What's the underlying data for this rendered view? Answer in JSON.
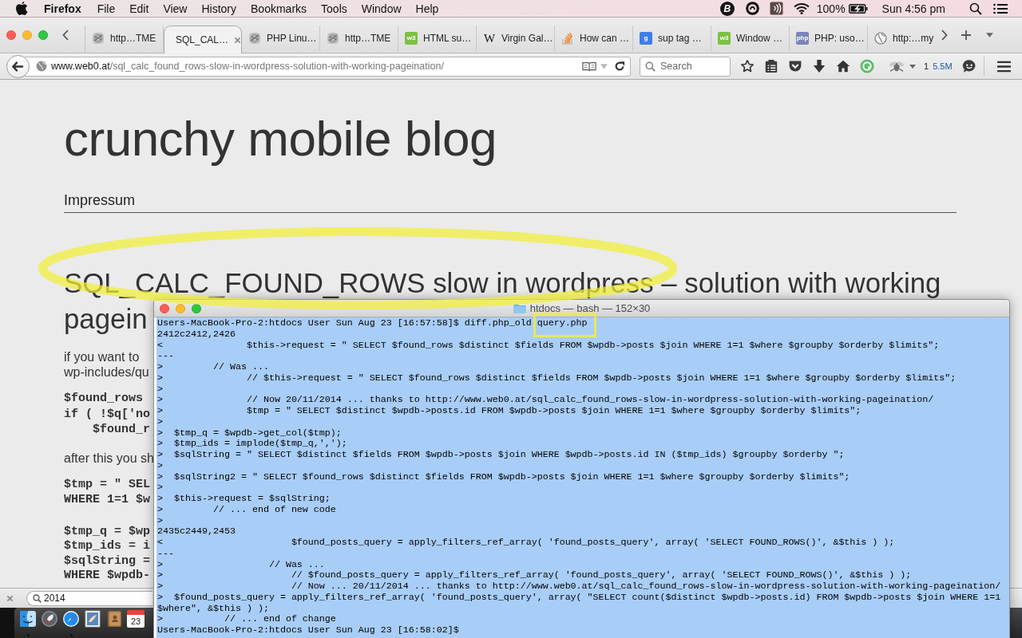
{
  "menu_bar": {
    "app_name": "Firefox",
    "menus": [
      "File",
      "Edit",
      "View",
      "History",
      "Bookmarks",
      "Tools",
      "Window",
      "Help"
    ],
    "status_items": [
      {
        "kind": "badge",
        "glyph": "B"
      },
      {
        "kind": "ring"
      },
      {
        "kind": "sound"
      },
      {
        "kind": "wifi"
      }
    ],
    "battery": "100%",
    "clock": "Sun 4:56 pm"
  },
  "browser": {
    "tabs": [
      {
        "title": "http…TME",
        "favicon": {
          "kind": "blur"
        },
        "selected": false
      },
      {
        "title": "SQL_CAL…",
        "selected": true
      },
      {
        "title": "PHP Linu…",
        "favicon": {
          "kind": "blur"
        },
        "selected": false
      },
      {
        "title": "http…TME",
        "favicon": {
          "kind": "blur"
        },
        "selected": false
      },
      {
        "title": "HTML su…",
        "favicon": {
          "kind": "tile",
          "color": "#7cc142",
          "glyph": "w3"
        },
        "selected": false
      },
      {
        "title": "Virgin Gal…",
        "favicon": {
          "kind": "glyph",
          "glyph": "W"
        },
        "selected": false
      },
      {
        "title": "How can …",
        "favicon": {
          "kind": "stack"
        },
        "selected": false
      },
      {
        "title": "sup tag …",
        "favicon": {
          "kind": "tile",
          "color": "#3f7ee8",
          "glyph": "g"
        },
        "selected": false
      },
      {
        "title": "Window …",
        "favicon": {
          "kind": "tile",
          "color": "#7cc142",
          "glyph": "w3"
        },
        "selected": false
      },
      {
        "title": "PHP: uso…",
        "favicon": {
          "kind": "tile",
          "color": "#7a86b8",
          "glyph": "php"
        },
        "selected": false
      },
      {
        "title": "http:…my",
        "favicon": {
          "kind": "globe"
        },
        "selected": false
      }
    ],
    "address_bar": {
      "host": "www.web0.at",
      "path": "/sql_calc_found_rows-slow-in-wordpress-solution-with-working-pageination/"
    },
    "search_field": {
      "placeholder": "Search"
    },
    "addon_labels": {
      "count": "1",
      "size": "5.5M"
    }
  },
  "page": {
    "site_title": "crunchy mobile blog",
    "nav_links": [
      "Impressum"
    ],
    "post_title_lines": [
      "SQL_CALC_FOUND_ROWS slow in wordpress – solution with working",
      "pagein"
    ],
    "blocks": [
      {
        "kind": "text",
        "lines": [
          "if you want to",
          "wp-includes/qu"
        ]
      },
      {
        "kind": "code",
        "lines": [
          "$found_rows",
          "if ( !$q['no",
          "    $found_r"
        ]
      },
      {
        "kind": "text",
        "lines": [
          "after this you sh"
        ]
      },
      {
        "kind": "code",
        "lines": [
          "$tmp = \" SEL",
          "WHERE 1=1 $w"
        ]
      },
      {
        "kind": "code",
        "lines": [
          "$tmp_q = $wp",
          "$tmp_ids = i",
          "$sqlString =",
          "WHERE $wpdb-"
        ]
      }
    ]
  },
  "find_bar": {
    "query": "2014"
  },
  "dock": {
    "items": [
      {
        "kind": "finder",
        "running": true
      },
      {
        "kind": "launchpad",
        "running": false
      },
      {
        "kind": "safari",
        "running": true
      },
      {
        "kind": "mail",
        "running": false
      },
      {
        "kind": "contacts",
        "running": false
      },
      {
        "kind": "calendar",
        "running": false,
        "day": "23"
      }
    ]
  },
  "terminal": {
    "title": "htdocs — bash — 152×30",
    "text_selected": true,
    "lines": [
      "Users-MacBook-Pro-2:htdocs User Sun Aug 23 [16:57:58]$ diff.php_old query.php",
      "2412c2412,2426",
      "<               $this->request = \" SELECT $found_rows $distinct $fields FROM $wpdb->posts $join WHERE 1=1 $where $groupby $orderby $limits\";",
      "---",
      ">         // Was ...",
      ">               // $this->request = \" SELECT $found_rows $distinct $fields FROM $wpdb->posts $join WHERE 1=1 $where $groupby $orderby $limits\";",
      ">",
      ">               // Now 20/11/2014 ... thanks to http://www.web0.at/sql_calc_found_rows-slow-in-wordpress-solution-with-working-pageination/",
      ">               $tmp = \" SELECT $distinct $wpdb->posts.id FROM $wpdb->posts $join WHERE 1=1 $where $groupby $orderby $limits\";",
      ">",
      ">  $tmp_q = $wpdb->get_col($tmp);",
      ">  $tmp_ids = implode($tmp_q,',');",
      ">  $sqlString = \" SELECT $distinct $fields FROM $wpdb->posts $join WHERE $wpdb->posts.id IN ($tmp_ids) $groupby $orderby \";",
      ">",
      ">  $sqlString2 = \" SELECT $found_rows $distinct $fields FROM $wpdb->posts $join WHERE 1=1 $where $groupby $orderby $limits\";",
      ">",
      ">  $this->request = $sqlString;",
      ">         // ... end of new code",
      ">",
      "2435c2449,2453",
      "<                       $found_posts_query = apply_filters_ref_array( 'found_posts_query', array( 'SELECT FOUND_ROWS()', &$this ) );",
      "---",
      ">                   // Was ...",
      ">                       // $found_posts_query = apply_filters_ref_array( 'found_posts_query', array( 'SELECT FOUND_ROWS()', &$this ) );",
      ">                       // Now ... 20/11/2014 ... thanks to http://www.web0.at/sql_calc_found_rows-slow-in-wordpress-solution-with-working-pageination/",
      ">  $found_posts_query = apply_filters_ref_array( 'found_posts_query', array( \"SELECT count($distinct $wpdb->posts.id) FROM $wpdb->posts $join WHERE 1=1",
      "$where\", &$this ) );",
      ">           // ... end of change",
      "Users-MacBook-Pro-2:htdocs User Sun Aug 23 [16:58:02]$"
    ]
  },
  "annotations": [
    {
      "kind": "ellipse"
    },
    {
      "kind": "rectangle"
    }
  ]
}
